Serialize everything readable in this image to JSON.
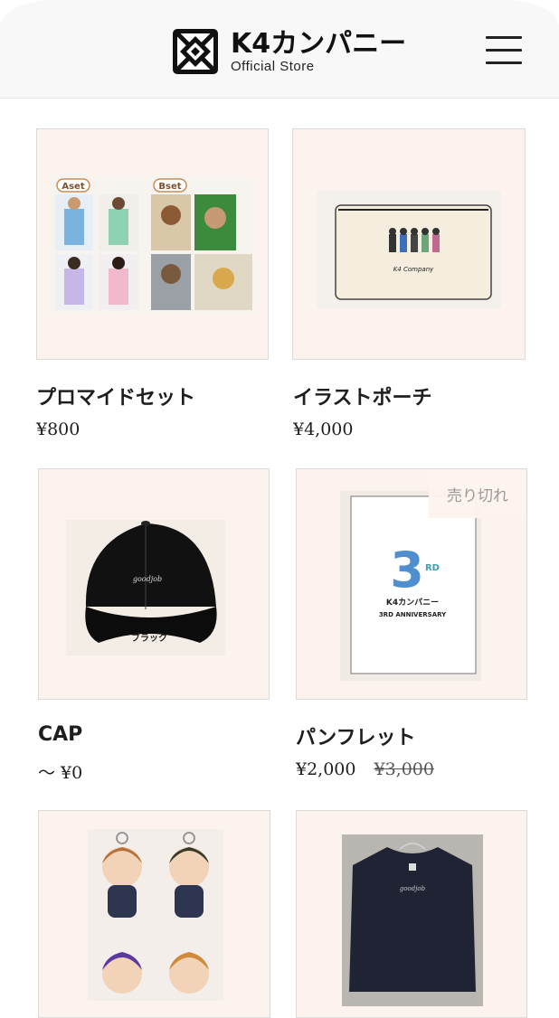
{
  "header": {
    "brand_name": "K4カンパニー",
    "brand_sub": "Official Store",
    "logo_icon": "k4-logo-icon",
    "menu_icon": "hamburger-menu-icon"
  },
  "products": [
    {
      "name": "プロマイドセット",
      "price": "¥800",
      "labels": {
        "a": "Aset",
        "b": "Bset"
      }
    },
    {
      "name": "イラストポーチ",
      "price": "¥4,000",
      "pouch_text": "K4 Company"
    },
    {
      "name": "CAP",
      "price": "〜 ¥0",
      "cap_text": "goodjob",
      "cap_label": "ブラック"
    },
    {
      "name": "パンフレット",
      "price": "¥2,000",
      "old_price": "¥3,000",
      "badge": "売り切れ",
      "cover_number": "3",
      "cover_rd": "RD",
      "cover_title": "K4カンパニー",
      "cover_sub": "3RD ANNIVERSARY"
    },
    {
      "name": "",
      "price": ""
    },
    {
      "name": "",
      "price": "",
      "tee_text": "goodjob"
    }
  ],
  "colors": {
    "thumb_bg": "#fdf3ee",
    "accent": "#1e1e1e"
  }
}
